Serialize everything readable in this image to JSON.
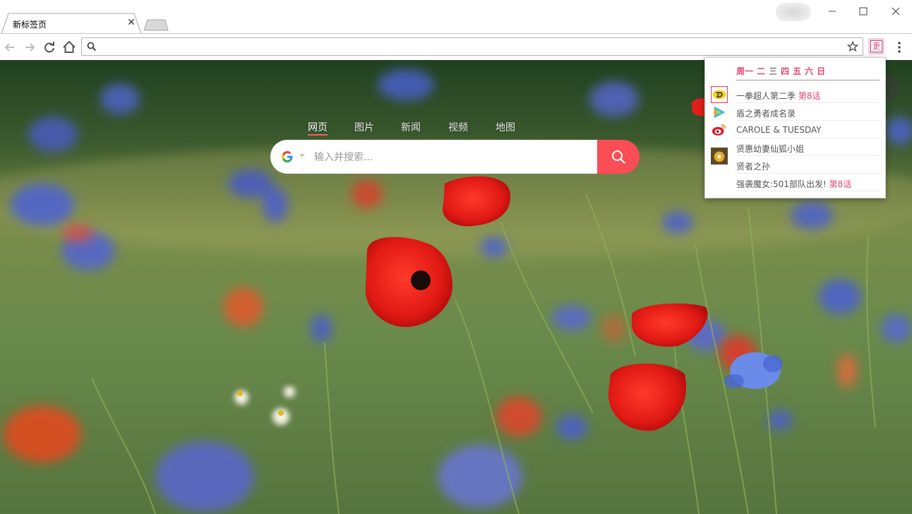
{
  "browser": {
    "tab_title": "新标签页",
    "address_value": "",
    "extension_label": "更"
  },
  "page": {
    "nav_tabs": [
      {
        "label": "网页",
        "active": true
      },
      {
        "label": "图片",
        "active": false
      },
      {
        "label": "新闻",
        "active": false
      },
      {
        "label": "视频",
        "active": false
      },
      {
        "label": "地图",
        "active": false
      }
    ],
    "search_placeholder": "输入并搜索...",
    "search_engine_icon": "google-g-icon"
  },
  "popup": {
    "weekdays": [
      {
        "label": "周一",
        "color": "#e2466e"
      },
      {
        "label": "二",
        "color": "#e2466e"
      },
      {
        "label": "三",
        "color": "#333333"
      },
      {
        "label": "四",
        "color": "#e2466e"
      },
      {
        "label": "五",
        "color": "#e2466e"
      },
      {
        "label": "六",
        "color": "#e2466e"
      },
      {
        "label": "日",
        "color": "#e2466e"
      }
    ],
    "items": [
      {
        "title": "一拳超人第二季",
        "episode": "第8话",
        "icon": "bilibili-style-icon"
      },
      {
        "title": "盾之勇者成名录",
        "episode": "",
        "icon": "tencent-video-icon"
      },
      {
        "title": "CAROLE & TUESDAY",
        "episode": "",
        "icon": "weibo-icon"
      },
      {
        "title": "贤惠幼妻仙狐小姐",
        "episode": "",
        "icon": ""
      },
      {
        "title": "贤者之孙",
        "episode": "",
        "icon": "app-thumb-icon"
      },
      {
        "title": "强袭魔女:501部队出发!",
        "episode": "第8话",
        "icon": ""
      }
    ]
  },
  "colors": {
    "accent_pink": "#e2466e",
    "search_button": "#fa4d55"
  }
}
